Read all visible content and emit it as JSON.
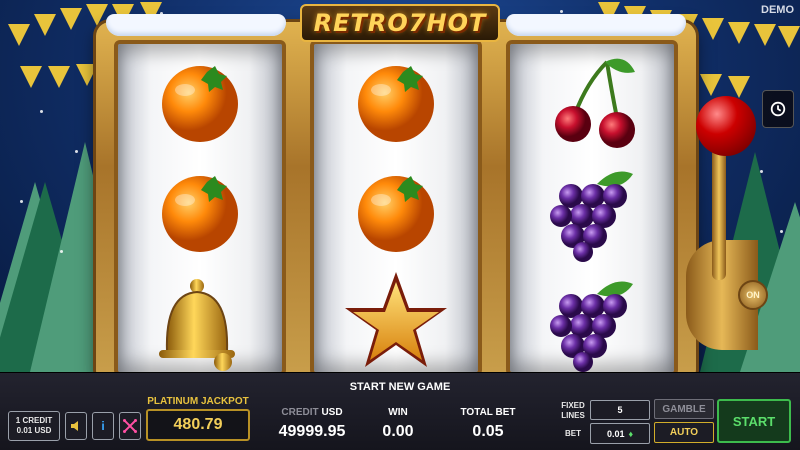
{
  "logo": {
    "text": "RETRO7HOT"
  },
  "demo_label": "DEMO",
  "lever": {
    "on_label": "ON"
  },
  "reels": [
    {
      "symbols": [
        "orange",
        "orange",
        "bell"
      ]
    },
    {
      "symbols": [
        "orange",
        "orange",
        "star"
      ]
    },
    {
      "symbols": [
        "cherries",
        "grapes",
        "grapes"
      ]
    }
  ],
  "status_message": "START NEW GAME",
  "credit_value": {
    "line1": "1 CREDIT",
    "line2": "0.01 USD"
  },
  "toolbar": {
    "sound_icon": "speaker-icon",
    "info_icon": "info-icon",
    "paylines_icon": "paylines-icon",
    "history_icon": "history-icon"
  },
  "jackpot": {
    "label": "PLATINUM JACKPOT",
    "value": "480.79"
  },
  "credit": {
    "label": "CREDIT",
    "unit": "USD",
    "value": "49999.95"
  },
  "win": {
    "label": "WIN",
    "value": "0.00"
  },
  "total_bet": {
    "label": "TOTAL BET",
    "value": "0.05"
  },
  "fixed_lines": {
    "label": "FIXED LINES",
    "value": "5"
  },
  "bet": {
    "label": "BET",
    "value": "0.01"
  },
  "buttons": {
    "gamble": "GAMBLE",
    "auto": "AUTO",
    "start": "START"
  },
  "colors": {
    "accent_gold": "#f3cf5a",
    "start_green": "#5bde6b",
    "cherry_red": "#c8102e",
    "grape_purple": "#6b2fa6"
  }
}
